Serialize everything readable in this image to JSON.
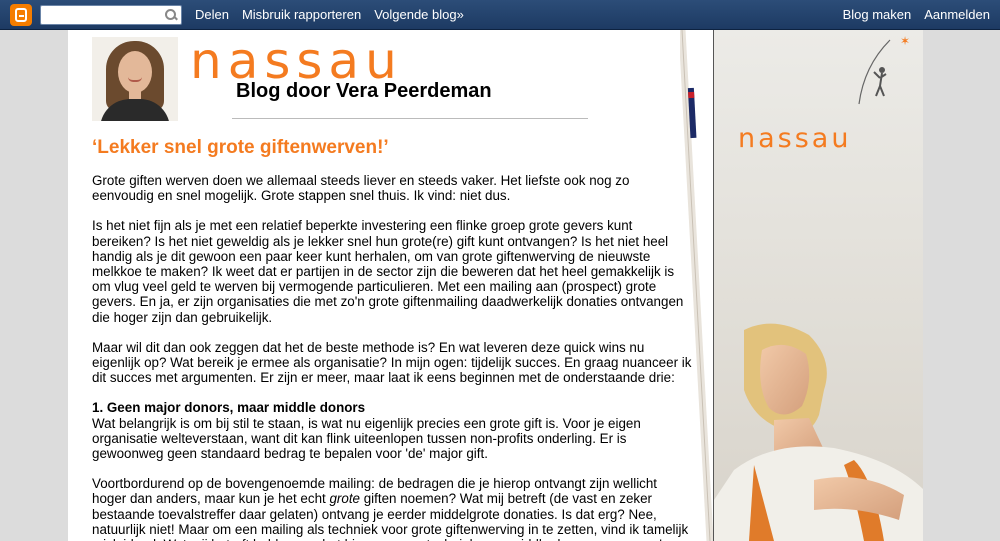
{
  "navbar": {
    "search_value": "",
    "search_placeholder": "",
    "links": [
      "Delen",
      "Misbruik rapporteren",
      "Volgende blog»"
    ],
    "right_links": [
      "Blog maken",
      "Aanmelden"
    ],
    "bg_color": "#1d3a63",
    "logo_color": "#f57d00"
  },
  "header": {
    "brand": "nassau",
    "subtitle": "Blog door Vera Peerdeman",
    "brand_color": "#f47b20"
  },
  "post": {
    "title": "‘Lekker snel grote giftenwerven!’",
    "paragraphs": [
      "Grote giften werven doen we allemaal steeds liever en steeds vaker. Het liefste ook nog zo eenvoudig en snel mogelijk. Grote stappen snel thuis. Ik vind: niet dus.",
      "Is het niet fijn als je met een relatief beperkte investering een flinke groep grote gevers kunt bereiken? Is het niet geweldig als je lekker snel hun grote(re) gift kunt ontvangen? Is het niet heel handig als je dit gewoon een paar keer kunt herhalen, om van grote giftenwerving de nieuwste melkkoe te maken? Ik weet dat er partijen in de sector zijn die beweren dat het heel gemakkelijk is om vlug veel geld te werven bij vermogende particulieren. Met een mailing aan (prospect) grote gevers. En ja, er zijn organisaties die met zo'n grote giftenmailing daadwerkelijk donaties ontvangen die hoger zijn dan gebruikelijk.",
      "Maar wil dit dan ook zeggen dat het de beste methode is? En wat leveren deze quick wins nu eigenlijk op? Wat bereik je ermee als organisatie? In mijn ogen: tijdelijk succes. En graag nuanceer ik dit succes met argumenten. Er zijn er meer, maar laat ik eens beginnen met de onderstaande drie:"
    ],
    "section_heading": "1. Geen major donors, maar middle donors",
    "section_paragraph": "Wat belangrijk is om bij stil te staan, is wat nu eigenlijk precies een grote gift is. Voor je eigen organisatie welteverstaan, want dit kan flink uiteenlopen tussen non-profits onderling. Er is gewoonweg geen standaard bedrag te bepalen voor 'de' major gift.",
    "last_paragraph_parts": [
      "Voortbordurend op de bovengenoemde mailing: de bedragen die je hierop ontvangt zijn wellicht hoger dan anders, maar kun je het echt ",
      "grote",
      " giften noemen? Wat mij betreft (de vast en zeker bestaande toevalstreffer daar gelaten) ontvang je eerder middelgrote donaties. Is dat erg? Nee, natuurlijk niet! Maar om een mailing als techniek voor grote giftenwerving in te zetten, vind ik tamelijk misleidend. Wat mij betreft hebben we het hier over een techniek voor middle donor programma's."
    ]
  },
  "sidebar": {
    "brand": "nassau",
    "icons": [
      "pole-vaulter-icon",
      "star-icon"
    ]
  }
}
